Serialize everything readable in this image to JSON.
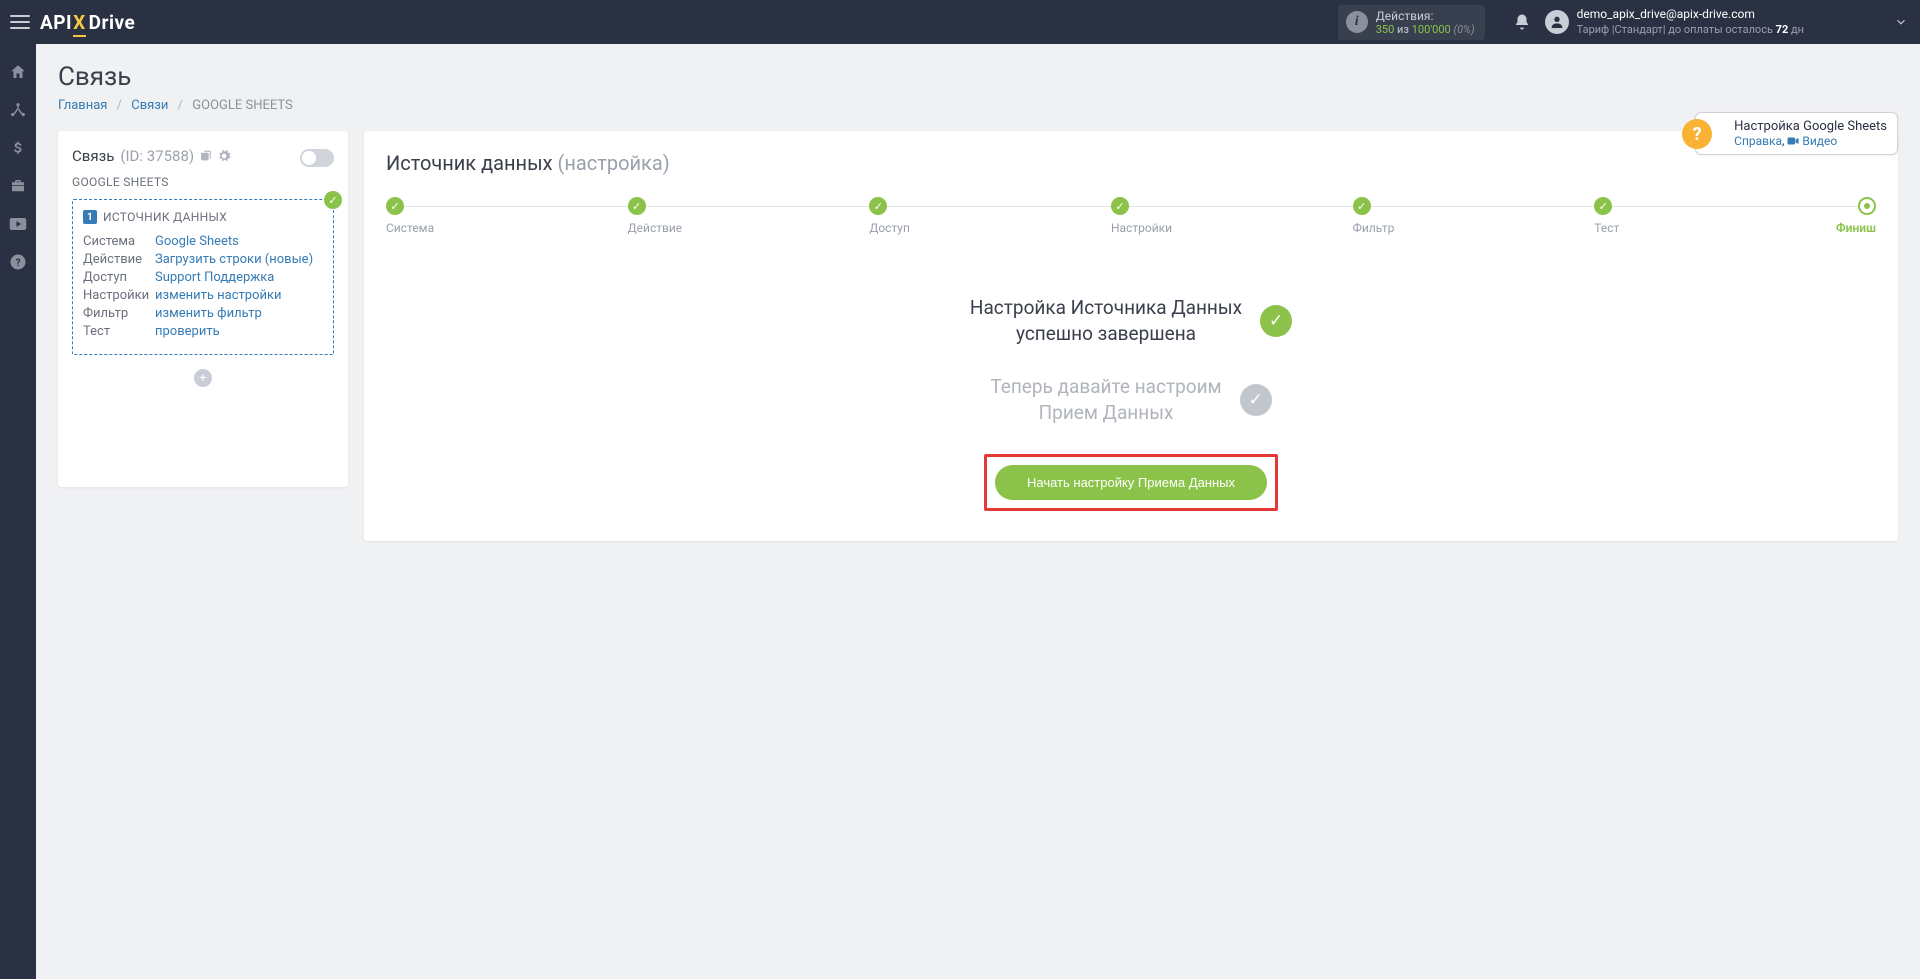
{
  "header": {
    "logo": {
      "api": "API",
      "x": "X",
      "drive": "Drive"
    },
    "actions": {
      "label": "Действия:",
      "used": "350",
      "sep": "из",
      "total": "100'000",
      "pct": "(0%)"
    },
    "user": {
      "email": "demo_apix_drive@apix-drive.com",
      "tariff_pre": "Тариф |Стандарт| до оплаты осталось ",
      "days": "72",
      "days_suf": " дн"
    }
  },
  "help": {
    "title": "Настройка Google Sheets",
    "help_link": "Справка",
    "comma": ", ",
    "video_link": "Видео"
  },
  "page": {
    "title": "Связь"
  },
  "breadcrumb": {
    "home": "Главная",
    "links": "Связи",
    "current": "GOOGLE SHEETS"
  },
  "left": {
    "title": "Связь",
    "id_label": "(ID: 37588)",
    "sheet": "GOOGLE SHEETS",
    "source": {
      "badge": "1",
      "title": "ИСТОЧНИК ДАННЫХ",
      "rows": [
        {
          "k": "Система",
          "v": "Google Sheets"
        },
        {
          "k": "Действие",
          "v": "Загрузить строки (новые)"
        },
        {
          "k": "Доступ",
          "v": "Support Поддержка"
        },
        {
          "k": "Настройки",
          "v": "изменить настройки"
        },
        {
          "k": "Фильтр",
          "v": "изменить фильтр"
        },
        {
          "k": "Тест",
          "v": "проверить"
        }
      ]
    }
  },
  "main": {
    "title": "Источник данных ",
    "subtitle": "(настройка)",
    "steps": [
      "Система",
      "Действие",
      "Доступ",
      "Настройки",
      "Фильтр",
      "Тест",
      "Финиш"
    ],
    "status1_l1": "Настройка Источника Данных",
    "status1_l2": "успешно завершена",
    "status2_l1": "Теперь давайте настроим",
    "status2_l2": "Прием Данных",
    "cta": "Начать настройку Приема Данных"
  }
}
